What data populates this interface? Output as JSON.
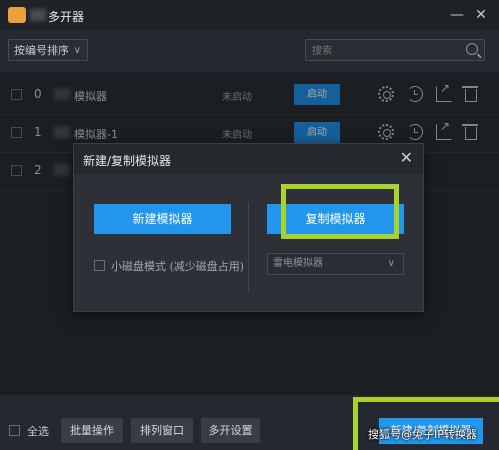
{
  "window": {
    "title": "多开器",
    "minimize": "—",
    "close": "✕"
  },
  "toolbar": {
    "sort_label": "按编号排序",
    "search_placeholder": "搜索"
  },
  "rows": [
    {
      "index": "0",
      "name": "模拟器",
      "status": "未启动",
      "start": "启动"
    },
    {
      "index": "1",
      "name": "模拟器-1",
      "status": "未启动",
      "start": "启动"
    },
    {
      "index": "2"
    }
  ],
  "dialog": {
    "title": "新建/复制模拟器",
    "close": "✕",
    "new_button": "新建模拟器",
    "copy_button": "复制模拟器",
    "small_disk": "小磁盘模式  (减少磁盘占用)",
    "emulator_select": "雷电模拟器"
  },
  "footer": {
    "select_all": "全选",
    "batch": "批量操作",
    "arrange": "排列窗口",
    "settings": "多开设置",
    "create": "新建/复制模拟器"
  },
  "watermark": "搜狐号@兔子IP转换器",
  "colors": {
    "accent": "#2196ec",
    "highlight": "#a9d22b"
  }
}
